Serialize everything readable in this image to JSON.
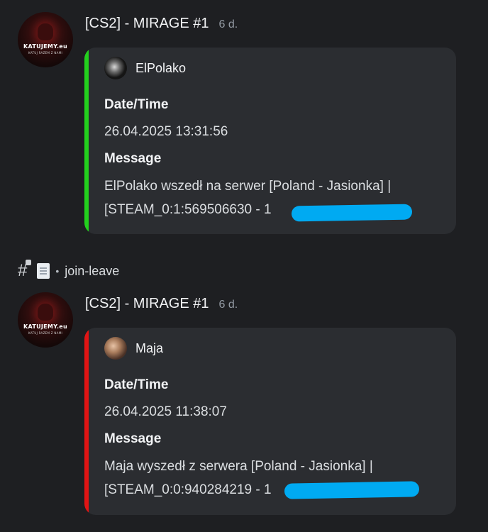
{
  "colors": {
    "background": "#1e1f22",
    "embed_bg": "#2b2d31",
    "join_bar": "#23d01d",
    "leave_bar": "#e11414",
    "redact": "#00aaf2"
  },
  "messages": [
    {
      "avatar": {
        "logo_text": "KATUJEMY.eu",
        "logo_subtext": "KATUJ RAZEM Z NAMI"
      },
      "author": "[CS2] - MIRAGE #1",
      "timestamp": "6 d.",
      "embed": {
        "bar_color": "#23d01d",
        "author_name": "ElPolako",
        "author_icon": "user-avatar-icon",
        "fields": [
          {
            "name": "Date/Time",
            "value": "26.04.2025 13:31:56"
          },
          {
            "name": "Message",
            "value_line1": "ElPolako wszedł na serwer [Poland - Jasionka] |",
            "value_line2": "[STEAM_0:1:569506630 - 1"
          }
        ]
      }
    },
    {
      "avatar": {
        "logo_text": "KATUJEMY.eu",
        "logo_subtext": "KATUJ RAZEM Z NAMI"
      },
      "author": "[CS2] - MIRAGE #1",
      "timestamp": "6 d.",
      "embed": {
        "bar_color": "#e11414",
        "author_name": "Maja",
        "author_icon": "user-avatar-icon",
        "fields": [
          {
            "name": "Date/Time",
            "value": "26.04.2025 11:38:07"
          },
          {
            "name": "Message",
            "value_line1": "Maja wyszedł z serwera [Poland - Jasionka] |",
            "value_line2": "[STEAM_0:0:940284219 - 1"
          }
        ]
      }
    }
  ],
  "channel": {
    "name": "join-leave",
    "icon": "hash-lock-icon",
    "emoji_icon": "page-icon"
  }
}
